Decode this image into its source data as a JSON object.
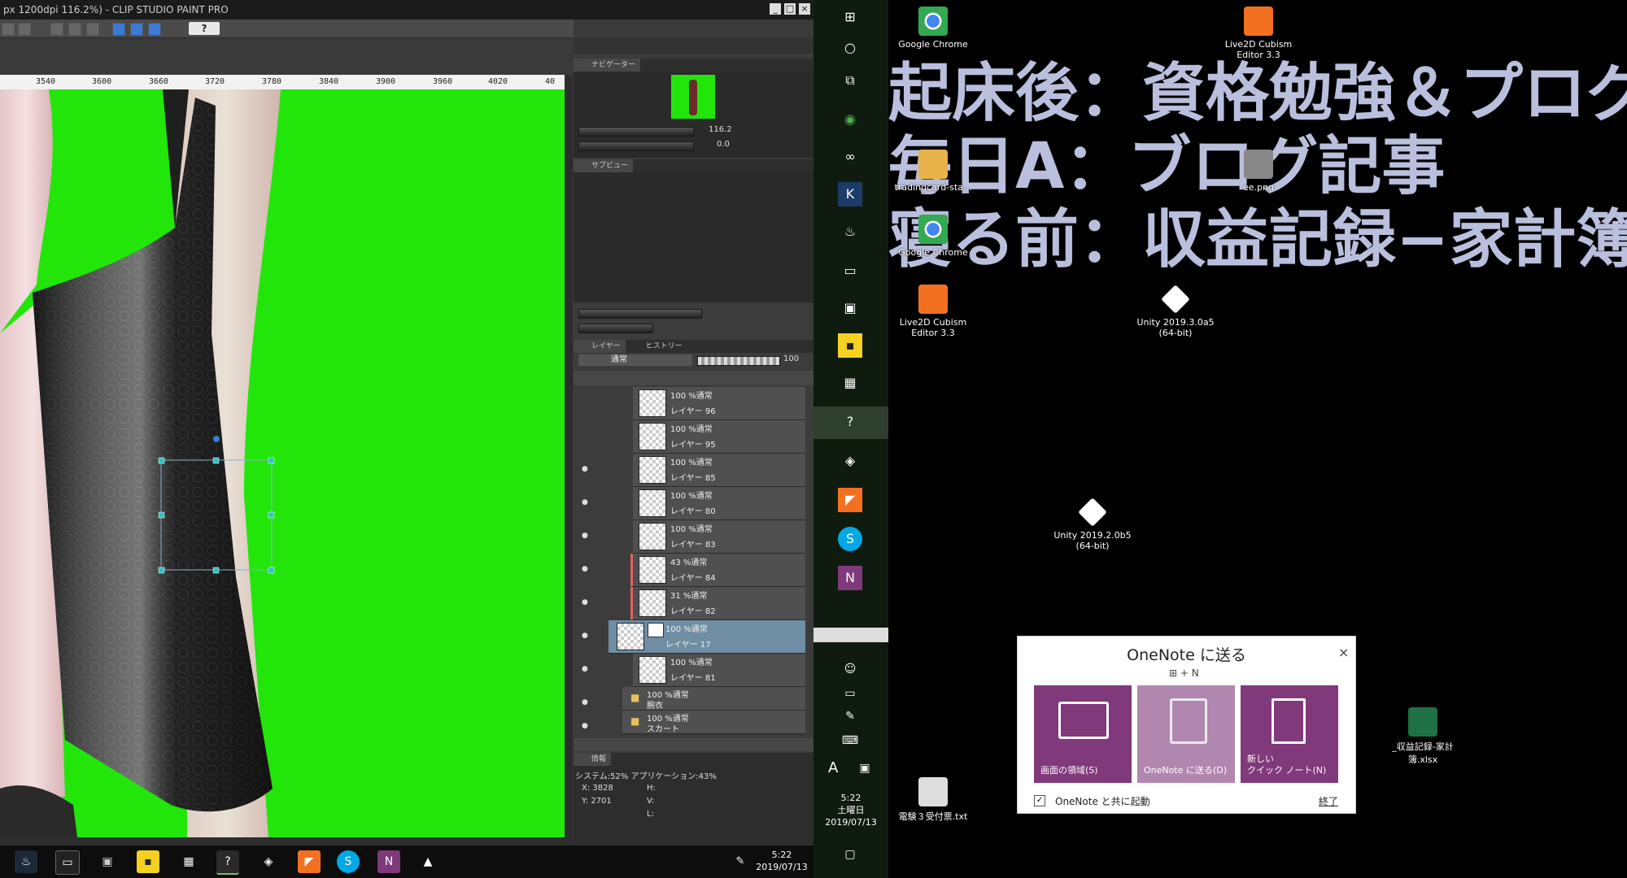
{
  "csp": {
    "title": "px 1200dpi 116.2%) - CLIP STUDIO PAINT PRO",
    "window_buttons": [
      "_",
      "□",
      "×"
    ],
    "help_label": "?",
    "ruler_ticks": [
      "3540",
      "3600",
      "3660",
      "3720",
      "3780",
      "3840",
      "3900",
      "3960",
      "4020",
      "40"
    ],
    "navigator_tab": "ナビゲーター",
    "zoom_value": "116.2",
    "rotate_value": "0.0",
    "subview_tab": "サブビュー",
    "layer_tab": "レイヤー",
    "history_tab": "ヒストリー",
    "blend_mode": "通常",
    "opacity_value": "100",
    "layers": [
      {
        "mode": "100 %通常",
        "name": "レイヤー 96",
        "eye": false,
        "red": false,
        "selected": false
      },
      {
        "mode": "100 %通常",
        "name": "レイヤー 95",
        "eye": false,
        "red": false,
        "selected": false
      },
      {
        "mode": "100 %通常",
        "name": "レイヤー 85",
        "eye": true,
        "red": false,
        "selected": false
      },
      {
        "mode": "100 %通常",
        "name": "レイヤー 80",
        "eye": true,
        "red": false,
        "selected": false
      },
      {
        "mode": "100 %通常",
        "name": "レイヤー 83",
        "eye": true,
        "red": false,
        "selected": false
      },
      {
        "mode": "43 %通常",
        "name": "レイヤー 84",
        "eye": true,
        "red": true,
        "selected": false
      },
      {
        "mode": "31 %通常",
        "name": "レイヤー 82",
        "eye": true,
        "red": true,
        "selected": false
      },
      {
        "mode": "100 %通常",
        "name": "レイヤー 17",
        "eye": true,
        "red": false,
        "selected": true
      },
      {
        "mode": "100 %通常",
        "name": "レイヤー 81",
        "eye": true,
        "red": false,
        "selected": false
      }
    ],
    "folders": [
      {
        "mode": "100 %通常",
        "name": "腕衣"
      },
      {
        "mode": "100 %通常",
        "name": "スカート"
      }
    ],
    "info_tab": "情報",
    "system_info": "システム:52% アプリケーション:43%",
    "coord_x": "X: 3828",
    "coord_y": "Y: 2701",
    "hsv": [
      "H:",
      "V:",
      "L:"
    ]
  },
  "taskbar": {
    "time": "5:22",
    "date": "2019/07/13"
  },
  "vtaskbar": {
    "time": "5:22",
    "day": "土曜日",
    "date": "2019/07/13",
    "ime_letter": "A"
  },
  "desktop": {
    "memo_lines": [
      "起床後：資格勉強＆プログ",
      "毎日A：ブログ記事",
      "寝る前：収益記録−家計簿"
    ],
    "icons": [
      {
        "label": "Google Chrome",
        "color": "#ffffff"
      },
      {
        "label": "Live2D Cubism Editor 3.3",
        "color": "#f37021"
      },
      {
        "label": "tradingcard-sta...",
        "color": "#e8b34a"
      },
      {
        "label": "ee.png",
        "color": "#888888"
      },
      {
        "label": "Google Chrome",
        "color": "#ffffff"
      },
      {
        "label": "Live2D Cubism Editor 3.3",
        "color": "#f37021"
      },
      {
        "label": "Unity 2019.3.0a5 (64-bit)",
        "color": "#ffffff"
      },
      {
        "label": "Unity 2019.2.0b5 (64-bit)",
        "color": "#ffffff"
      },
      {
        "label": "_収益記録-家計簿.xlsx",
        "color": "#1e7145"
      },
      {
        "label": "電験３受付票.txt",
        "color": "#dddddd"
      }
    ]
  },
  "onenote": {
    "title": "OneNote に送る",
    "shortcut": "+ N",
    "close": "×",
    "tile1": "画面の領域(S)",
    "tile2": "OneNote に送る(D)",
    "tile3_line1": "新しい",
    "tile3_line2": "クイック ノート(N)",
    "checkbox_label": "OneNote と共に起動",
    "exit": "終了"
  }
}
